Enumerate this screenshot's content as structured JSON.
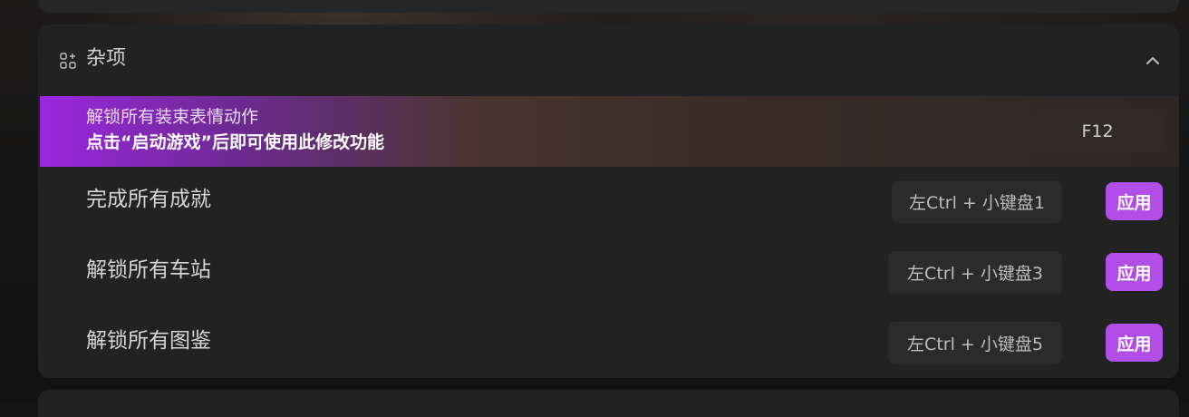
{
  "section": {
    "title": "杂项",
    "icon": "grid-plus-icon",
    "collapse_icon": "chevron-up-icon"
  },
  "tooltip": {
    "line1": "解锁所有装束表情动作",
    "line2": "点击“启动游戏”后即可使用此修改功能",
    "hotkey": "F12"
  },
  "items": [
    {
      "label": "完成所有成就",
      "hotkey": "左Ctrl + 小键盘1",
      "apply_label": "应用"
    },
    {
      "label": "解锁所有车站",
      "hotkey": "左Ctrl + 小键盘3",
      "apply_label": "应用"
    },
    {
      "label": "解锁所有图鉴",
      "hotkey": "左Ctrl + 小键盘5",
      "apply_label": "应用"
    }
  ],
  "colors": {
    "accent": "#b34de8",
    "tooltip_gradient_start": "#9a27e0",
    "card_bg": "#222222"
  }
}
